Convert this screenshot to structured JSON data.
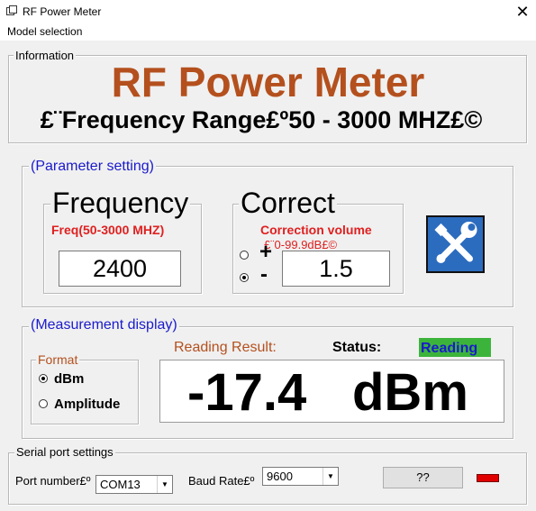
{
  "window": {
    "title": "RF Power Meter",
    "close_glyph": "✕"
  },
  "menu": {
    "model_selection": "Model selection"
  },
  "info": {
    "legend": "Information",
    "heading": "RF Power Meter",
    "subheading": "£¨Frequency Range£º50 - 3000 MHZ£©",
    "heading_color": "#b4501e"
  },
  "params": {
    "legend": "(Parameter setting)",
    "frequency": {
      "title": "Frequency",
      "hint": "Freq(50-3000 MHZ)",
      "value": "2400"
    },
    "correct": {
      "title": "Correct",
      "hint": "Correction volume",
      "range": "£¨0-99.9dB£©",
      "plus": "+",
      "minus": "-",
      "value": "1.5",
      "plus_selected": false,
      "minus_selected": true
    },
    "settings_button_icon": "tools-icon"
  },
  "measure": {
    "legend": "(Measurement display)",
    "format": {
      "legend": "Format",
      "options": [
        "dBm",
        "Amplitude"
      ],
      "selected": "dBm"
    },
    "reading_result_label": "Reading Result:",
    "status_label": "Status:",
    "status_value": "Reading",
    "status_bg": "#3cb43c",
    "reading_value": "-17.4",
    "reading_unit": "dBm"
  },
  "serial": {
    "legend": "Serial port settings",
    "port_label": "Port number£º",
    "port_value": "COM13",
    "baud_label": "Baud Rate£º",
    "baud_value": "9600",
    "action_button": "??",
    "indicator_color": "#e00000"
  }
}
